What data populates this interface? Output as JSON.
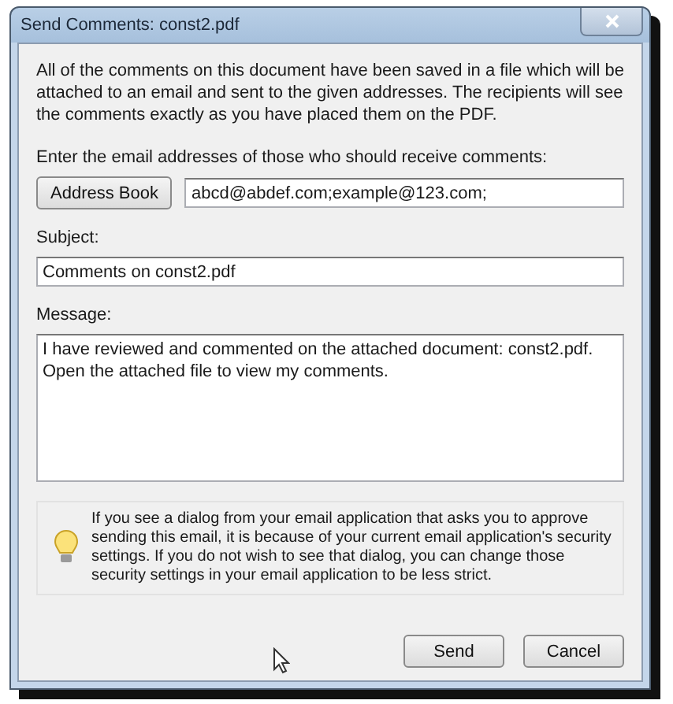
{
  "window": {
    "title": "Send Comments: const2.pdf"
  },
  "intro": "All of the comments on this document have been saved in a file which will be attached to an email and sent to the given addresses. The recipients will see the comments exactly as you have placed them on the PDF.",
  "recipients": {
    "label": "Enter the email addresses of those who should receive comments:",
    "button": "Address Book",
    "value": "abcd@abdef.com;example@123.com;"
  },
  "subject": {
    "label": "Subject:",
    "value": "Comments on const2.pdf"
  },
  "message": {
    "label": "Message:",
    "value": "I have reviewed and commented on the attached document: const2.pdf. Open the attached file to view my comments."
  },
  "tip": "If you see a dialog from your email application that asks you to approve sending this email, it is because of your current email application's security settings.  If you do not wish to see that dialog, you can change those security settings in your email application to be less strict.",
  "buttons": [
    "Send",
    "Cancel"
  ]
}
